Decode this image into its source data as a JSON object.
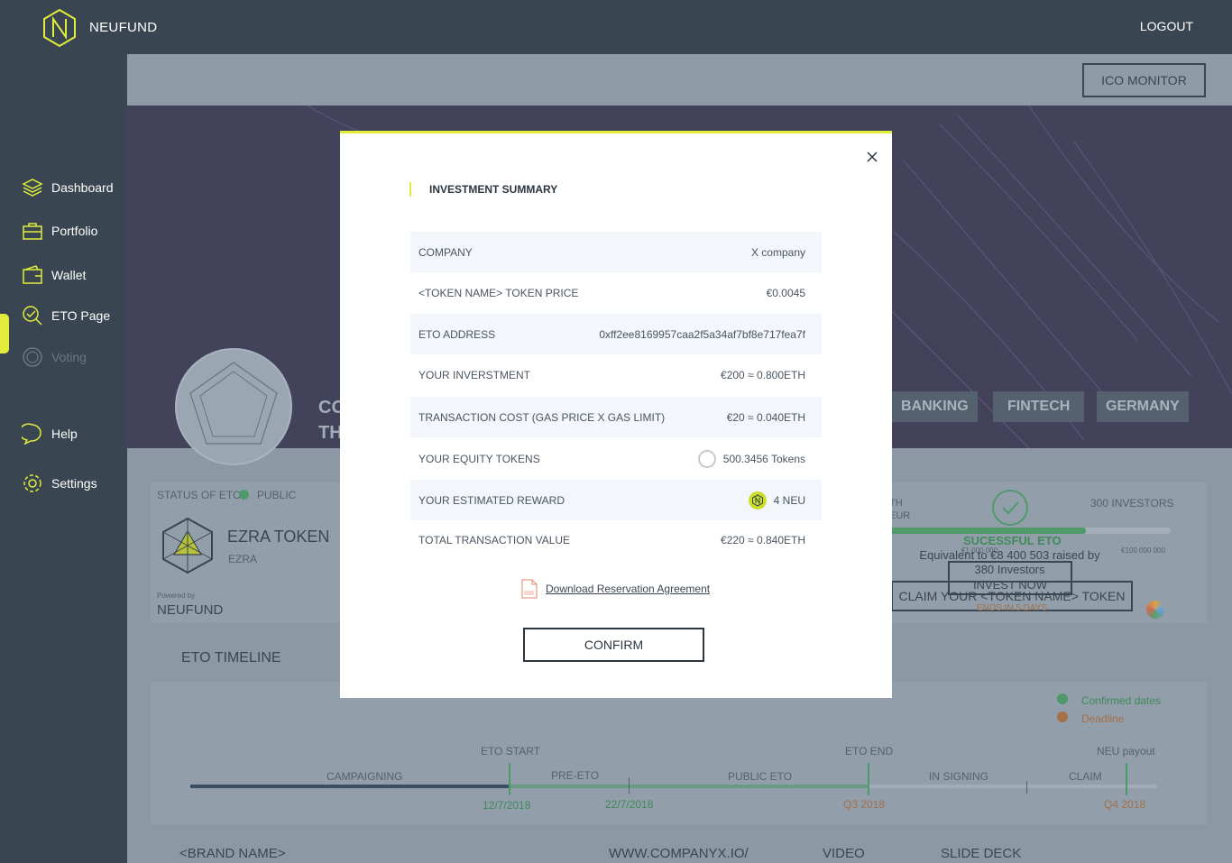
{
  "header": {
    "brand": "NEUFUND",
    "logout_label": "LOGOUT"
  },
  "sidebar": {
    "items": [
      {
        "label": "Dashboard",
        "icon": "dashboard-icon"
      },
      {
        "label": "Portfolio",
        "icon": "portfolio-icon"
      },
      {
        "label": "Wallet",
        "icon": "wallet-icon"
      },
      {
        "label": "ETO Page",
        "icon": "eto-page-icon",
        "active": true
      },
      {
        "label": "Voting",
        "icon": "vote-icon",
        "disabled": true
      },
      {
        "label": "Help",
        "icon": "help-icon"
      },
      {
        "label": "Settings",
        "icon": "settings-icon"
      }
    ]
  },
  "page": {
    "ico_monitor_label": "ICO MONITOR",
    "hero_title_line1": "CO",
    "hero_title_line2": "TH",
    "tags": [
      "BANKING",
      "FINTECH",
      "GERMANY"
    ],
    "status_label": "STATUS OF ETO",
    "status_value": "PUBLIC",
    "token_name": "EZRA TOKEN",
    "token_symbol": "EZRA",
    "powered_by": "Powered by",
    "powered_brand": "NEUFUND",
    "stat_a_line1": "TH",
    "stat_a_line2": "EUR",
    "investors": "300 INVESTORS",
    "success": "SUCESSFUL ETO",
    "cap_min": "€1 000 000",
    "cap_max": "€100 000 000",
    "raised_line1": "Equivalent to €8 400 503 raised by",
    "raised_line2": "380 Investors",
    "invest_now": "INVEST NOW",
    "claim_label": "CLAIM YOUR <TOKEN NAME> TOKEN",
    "ends_in": "ENDS IN 5 DAYS",
    "progress": 0.7,
    "timeline": {
      "title": "ETO TIMELINE",
      "legend_confirmed": "Confirmed dates",
      "legend_deadline": "Deadline",
      "eto_start": "ETO START",
      "eto_end": "ETO END",
      "neu_payout": "NEU payout",
      "phases": [
        "CAMPAIGNING",
        "PRE-ETO",
        "PUBLIC ETO",
        "IN SIGNING",
        "CLAIM"
      ],
      "dates": [
        "12/7/2018",
        "22/7/2018",
        "Q3 2018",
        "Q4 2018"
      ]
    },
    "footer_links": [
      "<BRAND NAME>",
      "WWW.COMPANYX.IO/",
      "VIDEO",
      "SLIDE DECK"
    ]
  },
  "modal": {
    "title": "INVESTMENT SUMMARY",
    "rows": [
      {
        "label": "COMPANY",
        "value": "X company"
      },
      {
        "label": "<TOKEN NAME> TOKEN PRICE",
        "value": "€0.0045"
      },
      {
        "label": "ETO ADDRESS",
        "value": "0xff2ee8169957caa2f5a34af7bf8e717fea7f"
      },
      {
        "label": "YOUR INVERSTMENT",
        "value": "€200 ≈ 0.800ETH"
      },
      {
        "label": "TRANSACTION COST (GAS PRICE X GAS LIMIT)",
        "value": "€20 ≈ 0.040ETH"
      },
      {
        "label": "YOUR EQUITY TOKENS",
        "value": "500.3456 Tokens"
      },
      {
        "label": "YOUR ESTIMATED REWARD",
        "value": "4 NEU"
      },
      {
        "label": "TOTAL TRANSACTION VALUE",
        "value": "€220 ≈ 0.840ETH"
      }
    ],
    "download_label": "Download Reservation Agreement",
    "confirm_label": "CONFIRM"
  },
  "colors": {
    "accent": "#e1ed3a",
    "sidebar": "#394651",
    "success": "#4e9a6a",
    "deadline": "#c87a3a"
  }
}
